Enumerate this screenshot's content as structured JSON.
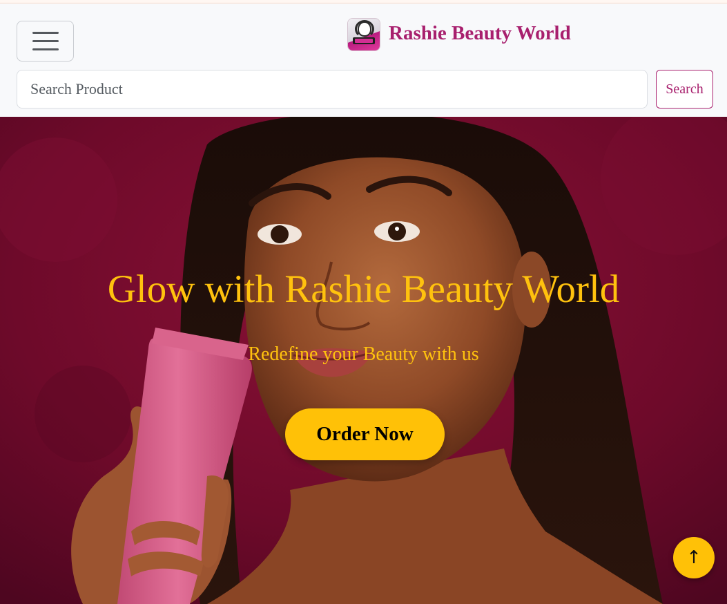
{
  "header": {
    "brand_name": "Rashie Beauty World",
    "brand_logo_icon": "brand-logo-icon",
    "menu_icon": "hamburger-menu-icon"
  },
  "search": {
    "placeholder": "Search Product",
    "value": "",
    "button_label": "Search"
  },
  "hero": {
    "title": "Glow with Rashie Beauty World",
    "subtitle": "Redefine your Beauty with us",
    "cta_label": "Order Now",
    "image": "woman-holding-pink-cosmetic-tube"
  },
  "scroll_top": {
    "label": "↑",
    "icon": "arrow-up-icon"
  },
  "colors": {
    "brand": "#a8206e",
    "accent": "#ffc107",
    "hero_title": "#ffc20e",
    "hero_background": "#6e0a2a",
    "navbar_background": "#f8f9fb"
  }
}
